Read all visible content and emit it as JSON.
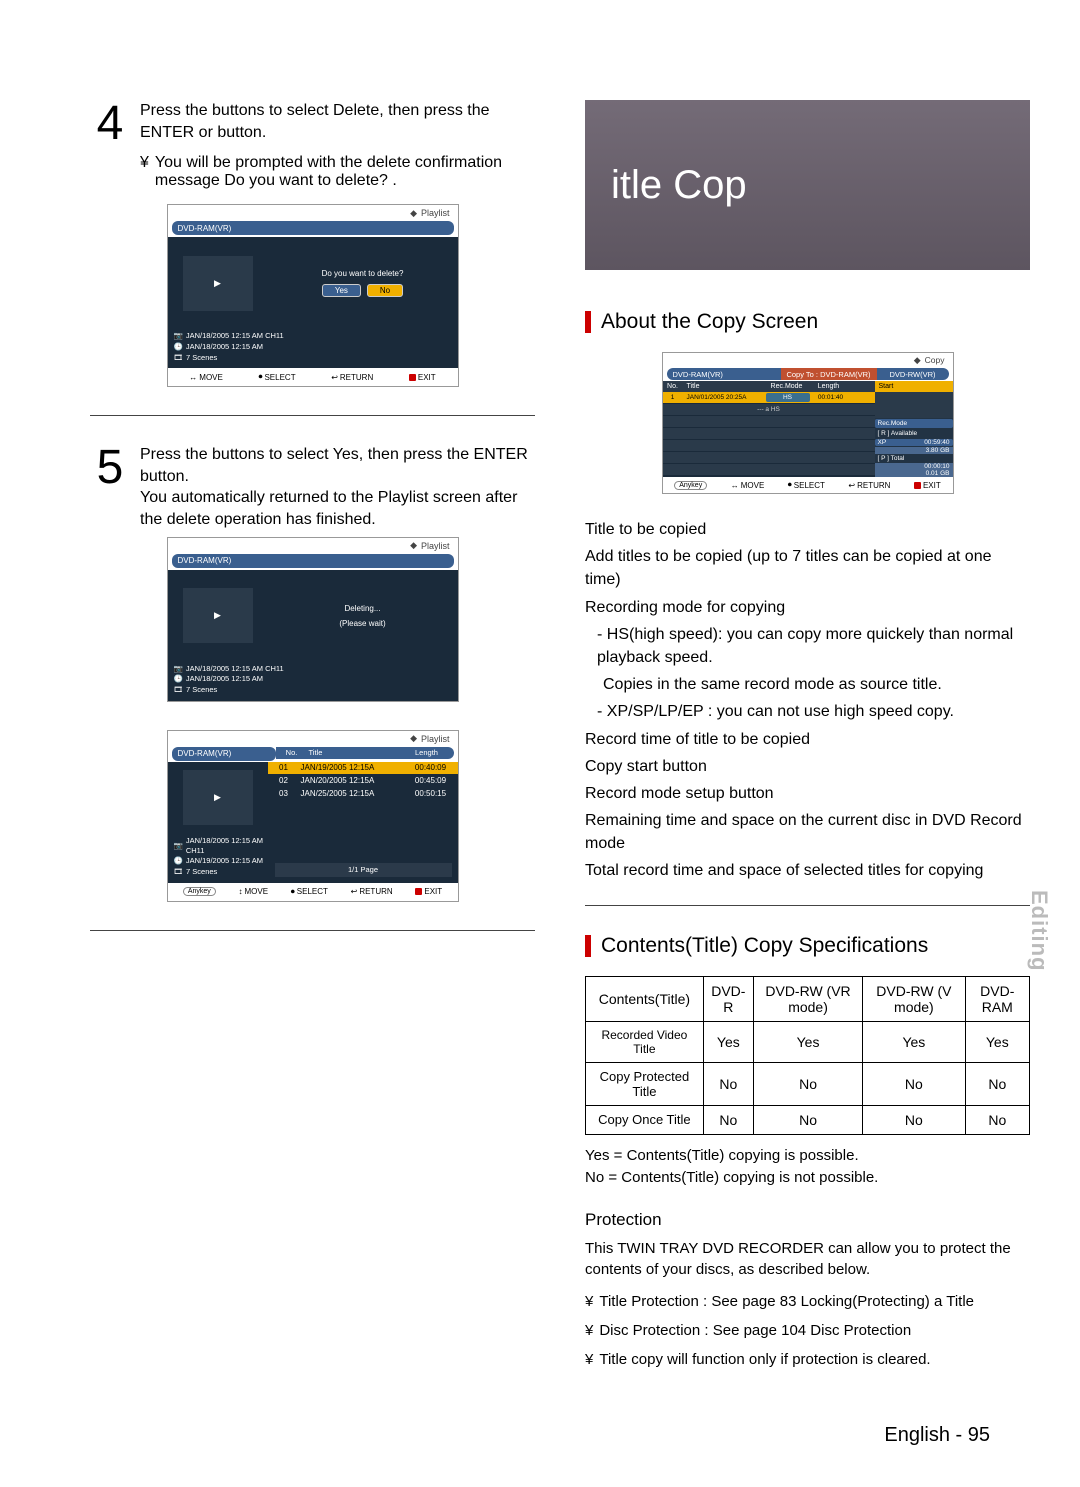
{
  "left": {
    "step4": {
      "num": "4",
      "text_a": "Press the ",
      "text_b": " buttons to select Delete, then press the ENTER or ",
      "text_c": " button.",
      "bullet_sym": "¥",
      "bullet": "You will be prompted with the delete confirmation message Do you want to delete? ."
    },
    "screen1": {
      "top_label": "Playlist",
      "hdr": "DVD-RAM(VR)",
      "msg": "Do you want to delete?",
      "yes": "Yes",
      "no": "No",
      "info1": "JAN/18/2005 12:15 AM CH11",
      "info2": "JAN/18/2005 12:15 AM",
      "info3": "7 Scenes",
      "foot_move": "MOVE",
      "foot_select": "SELECT",
      "foot_return": "RETURN",
      "foot_exit": "EXIT"
    },
    "step5": {
      "num": "5",
      "text_a": "Press the ",
      "text_b": " buttons to select Yes, then press the ENTER button.",
      "text_c": "You automatically returned to the Playlist screen after the delete operation has finished."
    },
    "screen2": {
      "top_label": "Playlist",
      "hdr": "DVD-RAM(VR)",
      "msg1": "Deleting...",
      "msg2": "(Please wait)",
      "info1": "JAN/18/2005 12:15 AM CH11",
      "info2": "JAN/18/2005 12:15 AM",
      "info3": "7 Scenes"
    },
    "screen3": {
      "top_label": "Playlist",
      "hdr": "DVD-RAM(VR)",
      "col_no": "No.",
      "col_title": "Title",
      "col_length": "Length",
      "rows": [
        {
          "no": "01",
          "title": "JAN/19/2005 12:15A",
          "length": "00:40:09"
        },
        {
          "no": "02",
          "title": "JAN/20/2005 12:15A",
          "length": "00:45:09"
        },
        {
          "no": "03",
          "title": "JAN/25/2005 12:15A",
          "length": "00:50:15"
        }
      ],
      "info1": "JAN/18/2005 12:15 AM CH11",
      "info2": "JAN/19/2005 12:15 AM",
      "info3": "7 Scenes",
      "page": "1/1 Page",
      "foot_move": "MOVE",
      "foot_select": "SELECT",
      "foot_return": "RETURN",
      "foot_exit": "EXIT",
      "anykey": "Anykey"
    }
  },
  "right": {
    "banner": "itle Cop",
    "about_head": "About the Copy Screen",
    "copy_screen": {
      "top_label": "Copy",
      "bar_a": "DVD-RAM(VR)",
      "bar_b": "Copy To : DVD-RAM(VR)",
      "bar_c": "DVD-RW(VR)",
      "th_no": "No.",
      "th_title": "Title",
      "th_rec": "Rec.Mode",
      "th_len": "Length",
      "row_no": "1",
      "row_title": "JAN/01/2005 20:25A",
      "row_mode": "HS",
      "row_len": "00:01:40",
      "blank_note": "--- a HS",
      "side_start": "Start",
      "side_recmode": "Rec.Mode",
      "side_avail": "[ R ] Available",
      "side_xp_l": "XP",
      "side_xp_r": "00:59:40",
      "side_size": "3.80 GB",
      "side_total": "[ P ] Total",
      "side_total_t": "00:00:10",
      "side_total_s": "0.01 GB",
      "anykey": "Anykey",
      "foot_move": "MOVE",
      "foot_select": "SELECT",
      "foot_return": "RETURN",
      "foot_exit": "EXIT"
    },
    "spec_list": [
      "Title to be copied",
      "Add titles to be copied (up to 7 titles can be copied at one time)",
      "Recording mode for copying",
      "- HS(high speed): you can copy more quickely than normal playback speed.",
      "Copies in the same record mode as source title.",
      "- XP/SP/LP/EP : you can not use high speed copy.",
      "Record time of title to be copied",
      "Copy start button",
      "Record mode setup button",
      "Remaining time and space on the current disc in DVD Record mode",
      "Total record time and space of selected titles for copying"
    ],
    "contents_head": "Contents(Title) Copy Specifications",
    "table": {
      "headers": [
        "Contents(Title)",
        "DVD-R",
        "DVD-RW (VR mode)",
        "DVD-RW (V mode)",
        "DVD-RAM"
      ],
      "rows": [
        {
          "label": "Recorded Video Title",
          "vals": [
            "Yes",
            "Yes",
            "Yes",
            "Yes"
          ]
        },
        {
          "label": "Copy Protected Title",
          "vals": [
            "No",
            "No",
            "No",
            "No"
          ]
        },
        {
          "label": "Copy Once Title",
          "vals": [
            "No",
            "No",
            "No",
            "No"
          ]
        }
      ]
    },
    "tbl_note1": "Yes = Contents(Title) copying is possible.",
    "tbl_note2": "No = Contents(Title) copying is not possible.",
    "prot_head": "Protection",
    "prot_para": "This TWIN TRAY DVD RECORDER can allow you to protect the contents of your discs, as described below.",
    "prot_b1": "Title Protection : See page 83  Locking(Protecting) a Title",
    "prot_b2": "Disc Protection : See page 104  Disc Protection",
    "prot_b3": "Title copy will function only if protection is cleared.",
    "bullet_sym": "¥"
  },
  "side_tab": "Editing",
  "page_foot": "English - 95"
}
